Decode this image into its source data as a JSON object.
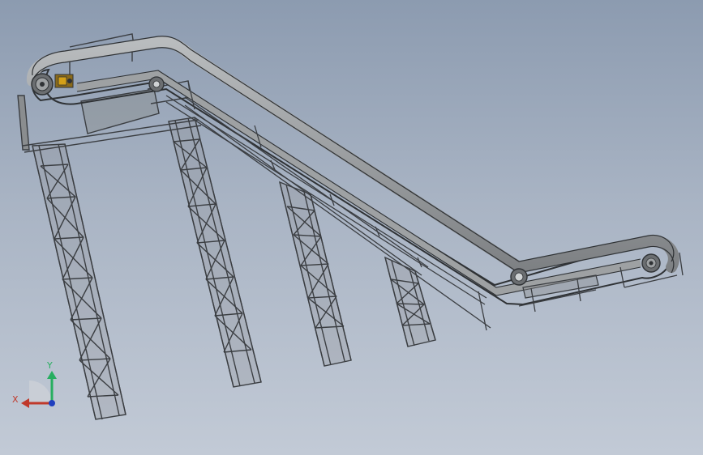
{
  "scene": {
    "colors": {
      "frame_dark": "#3b3e42",
      "frame_face": "#8a8d8f",
      "belt_face": "#9ea1a3",
      "belt_edge": "#2f3235",
      "motor": "#b8860b"
    }
  },
  "triad": {
    "x_label": "X",
    "y_label": "Y",
    "x_color": "#c0392b",
    "y_color": "#27ae60",
    "z_color": "#1f3fbf"
  }
}
